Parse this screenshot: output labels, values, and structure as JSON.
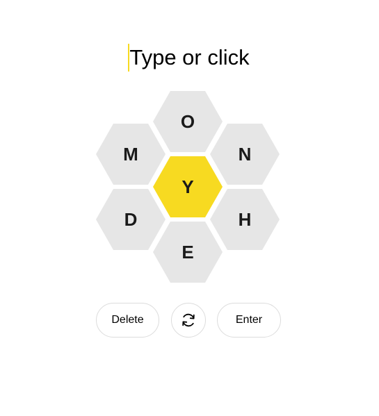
{
  "input": {
    "placeholder": "Type or click"
  },
  "hive": {
    "center_letter": "Y",
    "outer_letters": {
      "top": "O",
      "upper_left": "M",
      "upper_right": "N",
      "lower_left": "D",
      "lower_right": "H",
      "bottom": "E"
    }
  },
  "controls": {
    "delete_label": "Delete",
    "shuffle_icon": "shuffle-icon",
    "enter_label": "Enter"
  },
  "colors": {
    "center_fill": "#f7da21",
    "outer_fill": "#e6e6e6",
    "caret": "#f7da21",
    "button_border": "#dcdcdc"
  }
}
